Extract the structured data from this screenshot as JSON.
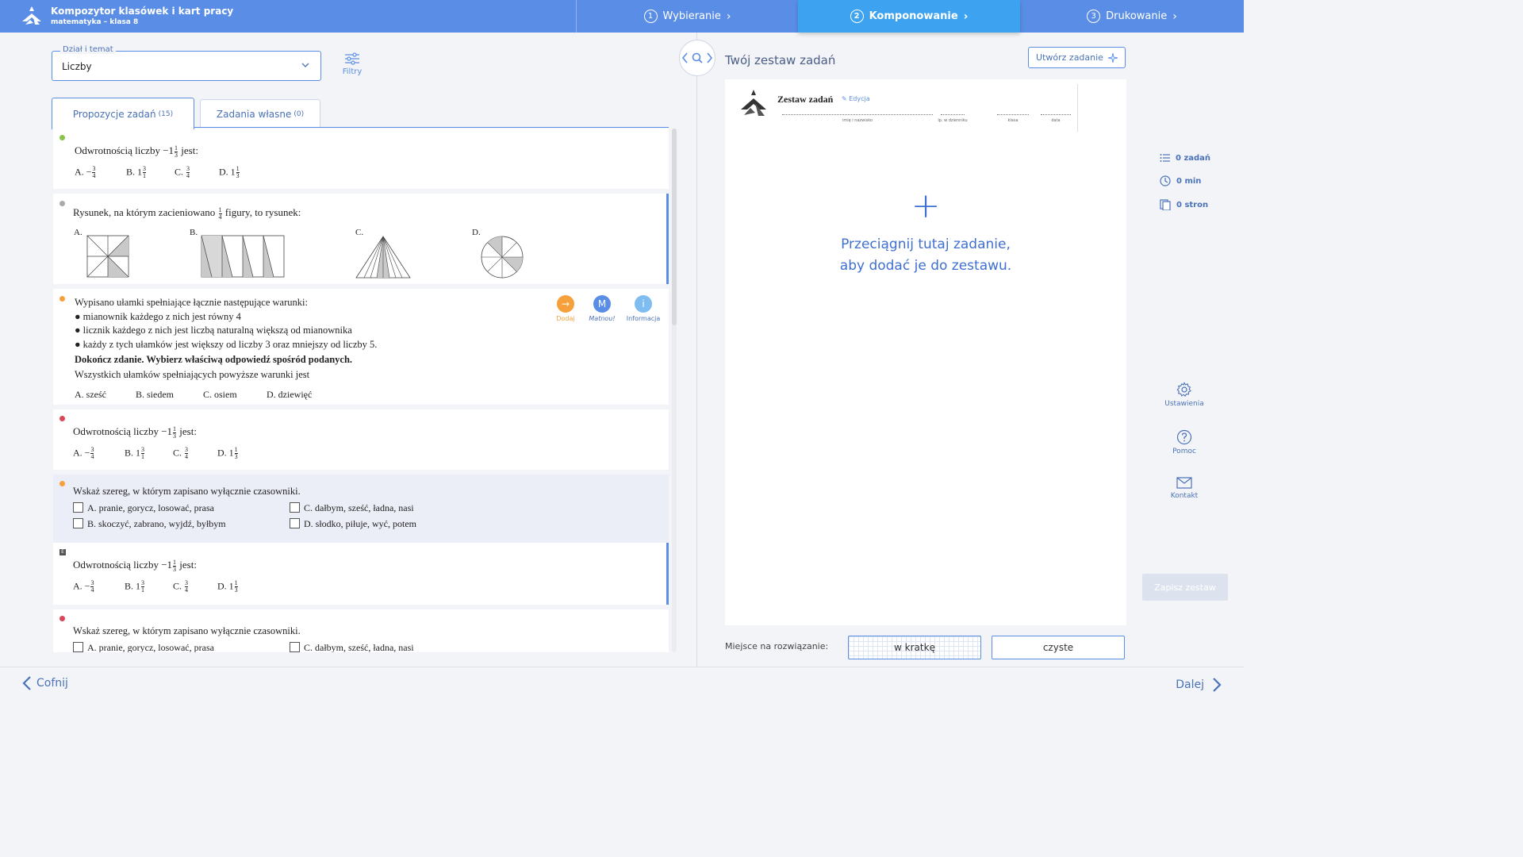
{
  "header": {
    "title": "Kompozytor klasówek i kart pracy",
    "subtitle": "matematyka – klasa 8",
    "steps": [
      {
        "num": "1",
        "label": "Wybieranie"
      },
      {
        "num": "2",
        "label": "Komponowanie"
      },
      {
        "num": "3",
        "label": "Drukowanie"
      }
    ]
  },
  "filters": {
    "section_legend": "Dział i temat",
    "section_value": "Liczby",
    "filter_label": "Filtry"
  },
  "tabs": [
    {
      "label": "Propozycje zadań",
      "count": "(15)"
    },
    {
      "label": "Zadania własne",
      "count": "(0)"
    }
  ],
  "tasks": {
    "t1": {
      "dot_color": "#8bc34a",
      "q_pre": "Odwrotnością liczby −1",
      "q_post": " jest:",
      "answers": [
        {
          "letter": "A. −",
          "n": "3",
          "d": "4"
        },
        {
          "letter": "B. 1",
          "n": "3",
          "d": "1"
        },
        {
          "letter": "C. ",
          "n": "3",
          "d": "4"
        },
        {
          "letter": "D. 1",
          "n": "1",
          "d": "3"
        }
      ]
    },
    "t2": {
      "dot_color": "#aaaaaa",
      "q_pre": "Rysunek, na którym zacieniowano ",
      "q_post": " figury, to rysunek:",
      "options": [
        "A.",
        "B.",
        "C.",
        "D."
      ]
    },
    "t3": {
      "dot_color": "#f5a03a",
      "lines": [
        "Wypisano ułamki spełniające łącznie następujące warunki:",
        "● mianownik każdego z nich jest równy 4",
        "● licznik każdego z nich jest liczbą naturalną większą od mianownika",
        "● każdy z tych ułamków jest większy od liczby 3 oraz mniejszy od liczby 5.",
        "Dokończ zdanie. Wybierz właściwą odpowiedź spośród podanych.",
        "Wszystkich ułamków spełniających powyższe warunki jest"
      ],
      "answers": [
        "A. sześć",
        "B. siedem",
        "C. osiem",
        "D. dziewięć"
      ],
      "actions": [
        {
          "label": "Dodaj",
          "glyph": "→",
          "color": "#f5a03a"
        },
        {
          "label": "Matnou!",
          "glyph": "M",
          "color": "#5a8ee6"
        },
        {
          "label": "Informacja",
          "glyph": "i",
          "color": "#7fbcf0"
        }
      ]
    },
    "t4": {
      "dot_color": "#d9475a"
    },
    "t5": {
      "dot_color": "#f5a03a",
      "question": "Wskaż szereg, w którym zapisano wyłącznie czasowniki.",
      "answers": [
        "A. pranie, gorycz, losować, prasa",
        "C. dałbym, sześć, ładna, nasi",
        "B. skoczyć, zabrano, wyjdź, byłbym",
        "D. słodko, piłuje, wyć, potem"
      ]
    },
    "t6": {
      "badge": "E"
    },
    "t7": {
      "dot_color": "#d9475a"
    }
  },
  "right": {
    "title": "Twój zestaw zadań",
    "create_button": "Utwórz zadanie",
    "sheet": {
      "title": "Zestaw zadań",
      "edit": "Edycja",
      "fields": [
        "imię i nazwisko",
        "lp. w dzienniku",
        "klasa",
        "data"
      ]
    },
    "drop_plus": "+",
    "drop_line1": "Przeciągnij tutaj zadanie,",
    "drop_line2": "aby dodać je do zestawu.",
    "space_label": "Miejsce na rozwiązanie:",
    "space_grid": "w kratkę",
    "space_clean": "czyste"
  },
  "stats": {
    "tasks": "0 zadań",
    "time": "0 min",
    "pages": "0 stron"
  },
  "tools": {
    "settings": "Ustawienia",
    "help": "Pomoc",
    "contact": "Kontakt",
    "save": "Zapisz zestaw"
  },
  "footer": {
    "back": "Cofnij",
    "next": "Dalej"
  }
}
